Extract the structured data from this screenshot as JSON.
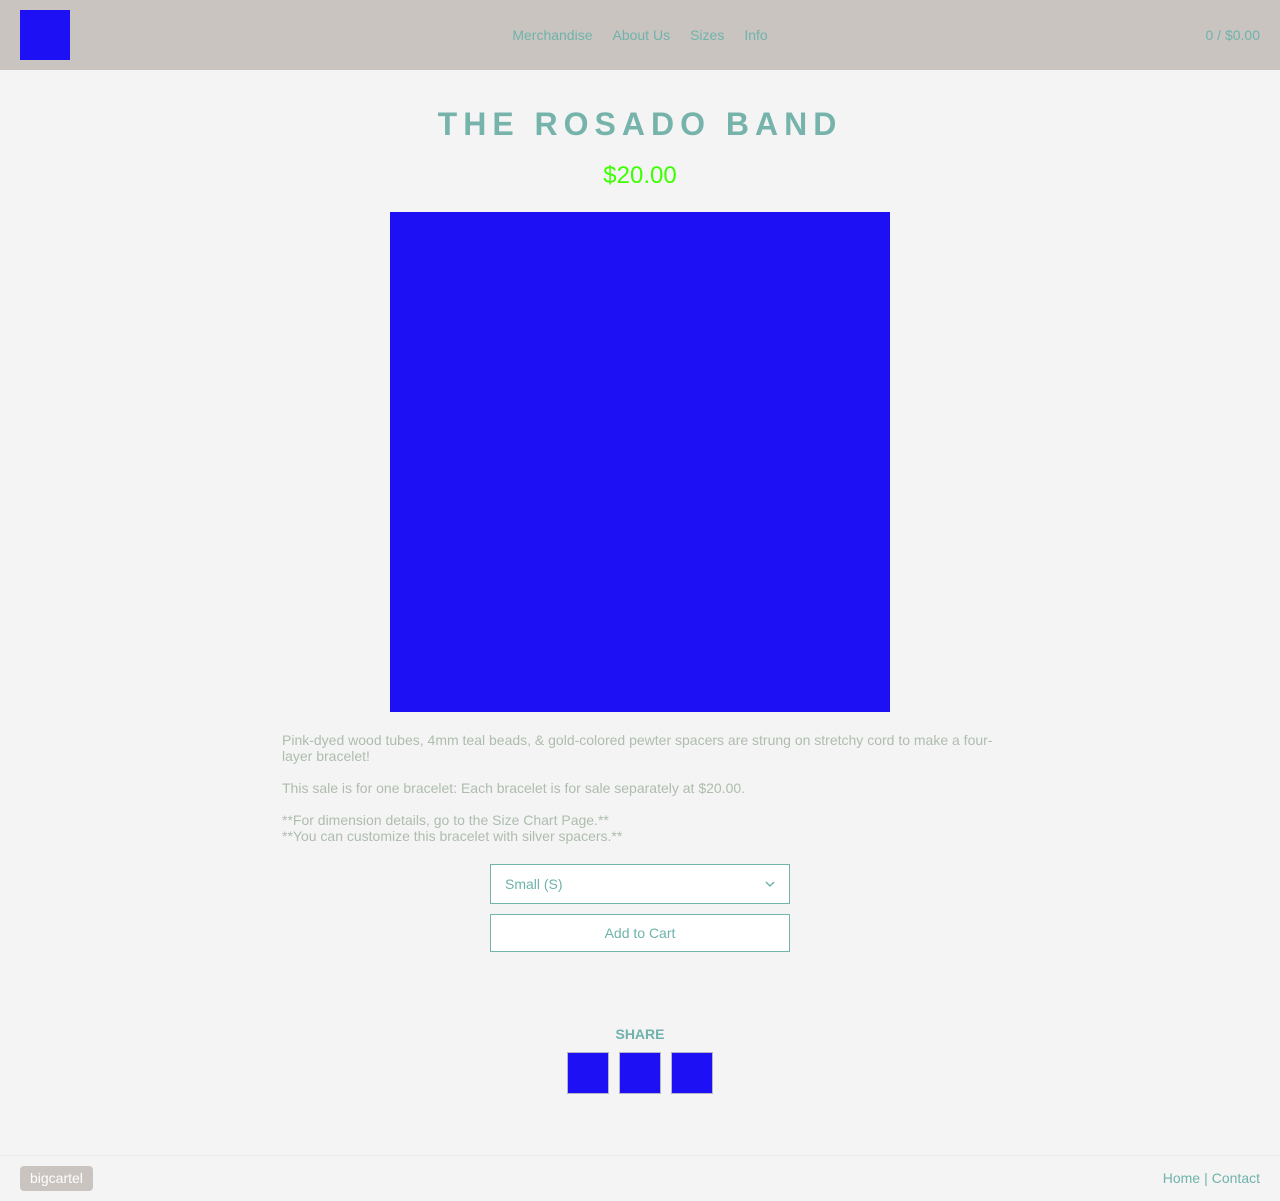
{
  "colors": {
    "header_bg": "#c9c4bf",
    "page_bg": "#f4f4f4",
    "accent": "#6fb3ab",
    "price": "#3cff00",
    "placeholder_image": "#1e10f5",
    "description_text": "#aebdad"
  },
  "header": {
    "logo_icon": "store-logo-icon",
    "nav": [
      {
        "label": "Merchandise"
      },
      {
        "label": "About Us"
      },
      {
        "label": "Sizes"
      },
      {
        "label": "Info"
      }
    ],
    "cart": "0 / $0.00"
  },
  "product": {
    "title": "THE ROSADO BAND",
    "price": "$20.00",
    "image_icon": "product-image",
    "description": [
      "Pink-dyed wood tubes, 4mm teal beads, & gold-colored pewter spacers are strung on stretchy cord to make a four-layer bracelet!",
      "This sale is for one bracelet: Each bracelet is for sale separately at $20.00.",
      "**For dimension details, go to the Size Chart Page.**",
      "**You can customize this bracelet with silver spacers.**"
    ],
    "option_selected": "Small (S)",
    "add_to_cart": "Add to Cart"
  },
  "share": {
    "label": "SHARE",
    "icons": [
      "facebook-icon",
      "twitter-icon",
      "pinterest-icon"
    ]
  },
  "footer": {
    "badge": "bigcartel",
    "links": [
      {
        "label": "Home"
      },
      {
        "label": "Contact"
      }
    ],
    "separator": "|"
  }
}
